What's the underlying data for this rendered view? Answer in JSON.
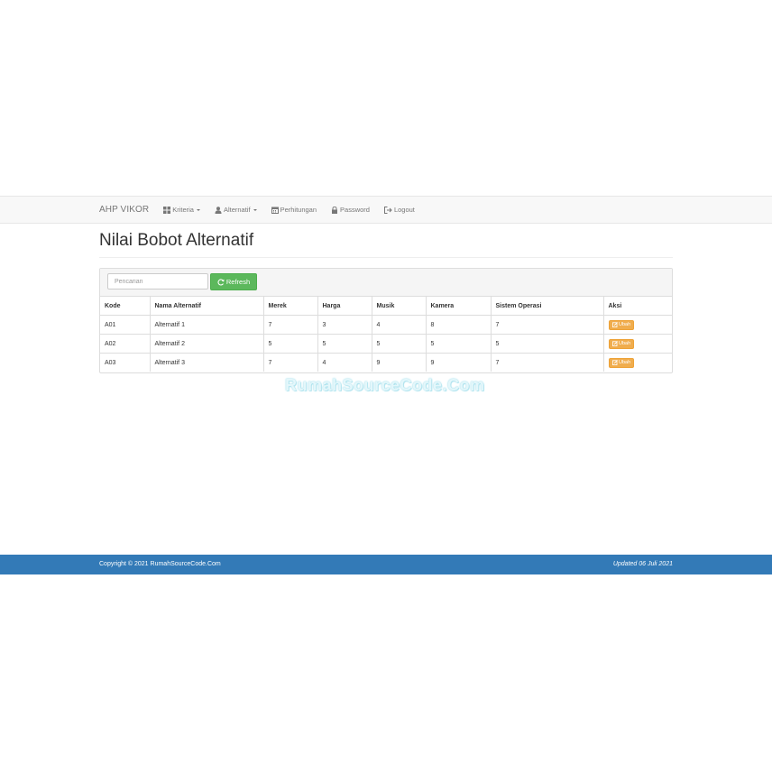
{
  "navbar": {
    "brand": "AHP VIKOR",
    "items": [
      {
        "label": "Kriteria",
        "icon": "th-large-icon",
        "dropdown": true
      },
      {
        "label": "Alternatif",
        "icon": "user-icon",
        "dropdown": true
      },
      {
        "label": "Perhitungan",
        "icon": "calendar-icon",
        "dropdown": false
      },
      {
        "label": "Password",
        "icon": "lock-icon",
        "dropdown": false
      },
      {
        "label": "Logout",
        "icon": "logout-icon",
        "dropdown": false
      }
    ]
  },
  "page": {
    "title": "Nilai Bobot Alternatif"
  },
  "toolbar": {
    "search_placeholder": "Pencarian",
    "search_value": "",
    "refresh_label": "Refresh"
  },
  "table": {
    "headers": [
      "Kode",
      "Nama Alternatif",
      "Merek",
      "Harga",
      "Musik",
      "Kamera",
      "Sistem Operasi",
      "Aksi"
    ],
    "rows": [
      [
        "A01",
        "Alternatif 1",
        "7",
        "3",
        "4",
        "8",
        "7"
      ],
      [
        "A02",
        "Alternatif 2",
        "5",
        "5",
        "5",
        "5",
        "5"
      ],
      [
        "A03",
        "Alternatif 3",
        "7",
        "4",
        "9",
        "9",
        "7"
      ]
    ],
    "action_label": "Ubah"
  },
  "watermark": "RumahSourceCode.Com",
  "footer": {
    "copyright": "Copyright © 2021 RumahSourceCode.Com",
    "updated": "Updated 06 Juli 2021"
  },
  "colors": {
    "primary": "#337ab7",
    "success": "#5cb85c",
    "warning": "#f0ad4e",
    "navbar_bg": "#f8f8f8"
  }
}
